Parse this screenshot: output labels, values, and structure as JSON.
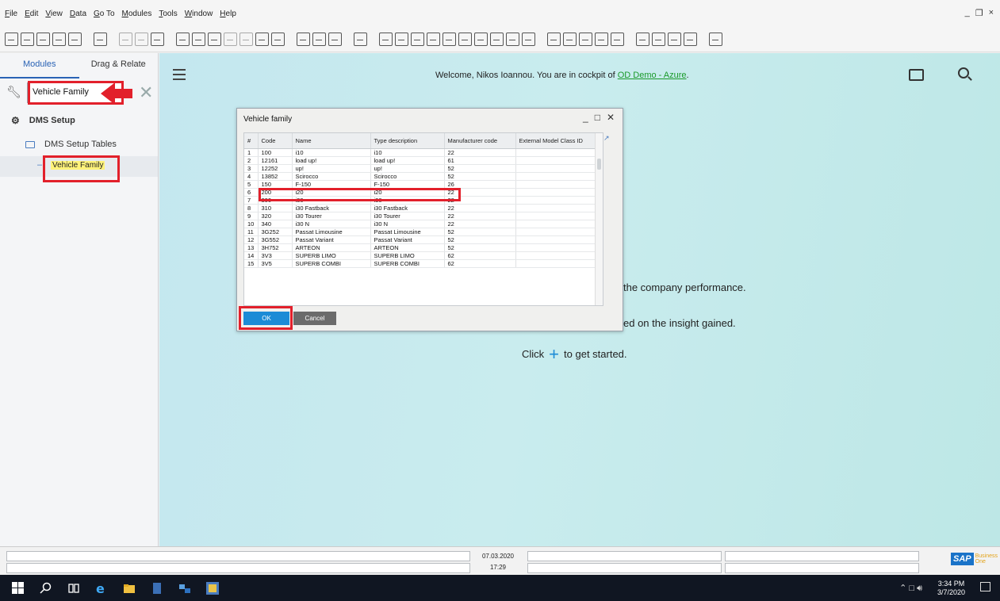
{
  "menu": {
    "items": [
      {
        "label": "File",
        "u": "F"
      },
      {
        "label": "Edit",
        "u": "E"
      },
      {
        "label": "View",
        "u": "V"
      },
      {
        "label": "Data",
        "u": "D"
      },
      {
        "label": "Go To",
        "u": "G"
      },
      {
        "label": "Modules",
        "u": "M"
      },
      {
        "label": "Tools",
        "u": "T"
      },
      {
        "label": "Window",
        "u": "W"
      },
      {
        "label": "Help",
        "u": "H"
      }
    ],
    "window_controls": [
      "_",
      "×"
    ]
  },
  "left_panel": {
    "tab_modules": "Modules",
    "tab_drag_relate": "Drag & Relate",
    "search_value": "Vehicle Family",
    "root_label": "DMS Setup",
    "folder_label": "DMS Setup Tables",
    "leaf_label": "Vehicle Family"
  },
  "cockpit": {
    "welcome_prefix": "Welcome, Nikos Ioannou. You are in cockpit of ",
    "company_link": "OD Demo - Azure",
    "welcome_suffix": ".",
    "line1": "the company performance.",
    "line2": "ed on the insight gained.",
    "line3_prefix": "Click",
    "line3_suffix": "to get started."
  },
  "dialog": {
    "title": "Vehicle family",
    "columns": [
      "#",
      "Code",
      "Name",
      "Type description",
      "Manufacturer code",
      "External Model Class ID"
    ],
    "rows": [
      [
        "1",
        "100",
        "i10",
        "i10",
        "22",
        ""
      ],
      [
        "2",
        "12161",
        "load up!",
        "load up!",
        "61",
        ""
      ],
      [
        "3",
        "12252",
        "up!",
        "up!",
        "52",
        ""
      ],
      [
        "4",
        "13852",
        "Scirocco",
        "Scirocco",
        "52",
        ""
      ],
      [
        "5",
        "150",
        "F-150",
        "F-150",
        "26",
        ""
      ],
      [
        "6",
        "200",
        "i20",
        "i20",
        "22",
        ""
      ],
      [
        "7",
        "300",
        "i30",
        "i30",
        "22",
        ""
      ],
      [
        "8",
        "310",
        "i30 Fastback",
        "i30 Fastback",
        "22",
        ""
      ],
      [
        "9",
        "320",
        "i30 Tourer",
        "i30 Tourer",
        "22",
        ""
      ],
      [
        "10",
        "340",
        "i30 N",
        "i30 N",
        "22",
        ""
      ],
      [
        "11",
        "3G252",
        "Passat Limousine",
        "Passat Limousine",
        "52",
        ""
      ],
      [
        "12",
        "3G552",
        "Passat Variant",
        "Passat Variant",
        "52",
        ""
      ],
      [
        "13",
        "3H752",
        "ARTEON",
        "ARTEON",
        "52",
        ""
      ],
      [
        "14",
        "3V3",
        "SUPERB LIMO",
        "SUPERB LIMO",
        "62",
        ""
      ],
      [
        "15",
        "3V5",
        "SUPERB COMBI",
        "SUPERB COMBI",
        "62",
        ""
      ]
    ],
    "ok_label": "OK",
    "cancel_label": "Cancel"
  },
  "statusbar": {
    "date": "07.03.2020",
    "time": "17:29",
    "logo_sap": "SAP",
    "logo_business": "Business",
    "logo_one": "One"
  },
  "taskbar": {
    "time": "3:34 PM",
    "date": "3/7/2020"
  },
  "colors": {
    "accent": "#1c8bd6",
    "highlight_red": "#e2202b",
    "leaf_highlight": "#fff37a",
    "link_green": "#1a9a2a"
  }
}
